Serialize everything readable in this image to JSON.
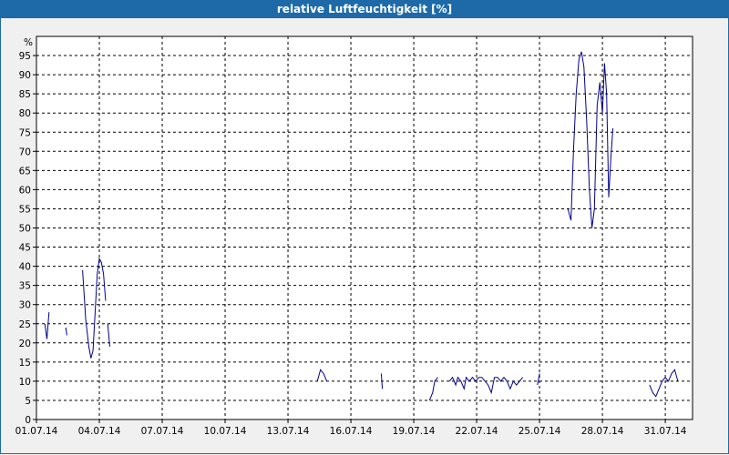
{
  "window": {
    "title": "relative Luftfeuchtigkeit [%]"
  },
  "colors": {
    "titlebar": "#1e6aa8",
    "series": "#00008b",
    "grid": "#000000",
    "background": "#f0f0f0",
    "plot": "#ffffff"
  },
  "chart_data": {
    "type": "line",
    "title": "relative Luftfeuchtigkeit [%]",
    "ylabel": "%",
    "xlabel": "",
    "ylim": [
      0,
      100
    ],
    "xlim": [
      1,
      32.3
    ],
    "yticks": [
      0,
      5,
      10,
      15,
      20,
      25,
      30,
      35,
      40,
      45,
      50,
      55,
      60,
      65,
      70,
      75,
      80,
      85,
      90,
      95
    ],
    "xticks": [
      {
        "x": 1,
        "label": "01.07.14"
      },
      {
        "x": 4,
        "label": "04.07.14"
      },
      {
        "x": 7,
        "label": "07.07.14"
      },
      {
        "x": 10,
        "label": "10.07.14"
      },
      {
        "x": 13,
        "label": "13.07.14"
      },
      {
        "x": 16,
        "label": "16.07.14"
      },
      {
        "x": 19,
        "label": "19.07.14"
      },
      {
        "x": 22,
        "label": "22.07.14"
      },
      {
        "x": 25,
        "label": "25.07.14"
      },
      {
        "x": 28,
        "label": "28.07.14"
      },
      {
        "x": 31,
        "label": "31.07.14"
      }
    ],
    "grid": true,
    "segments": [
      [
        [
          1.4,
          25
        ],
        [
          1.5,
          21
        ],
        [
          1.6,
          28
        ]
      ],
      [
        [
          2.4,
          24
        ],
        [
          2.45,
          22
        ]
      ],
      [
        [
          3.2,
          39
        ],
        [
          3.35,
          26
        ],
        [
          3.5,
          19
        ],
        [
          3.6,
          16
        ],
        [
          3.7,
          18
        ],
        [
          3.8,
          28
        ],
        [
          3.9,
          38
        ],
        [
          4.0,
          42
        ],
        [
          4.1,
          41
        ],
        [
          4.2,
          38
        ],
        [
          4.3,
          31
        ]
      ],
      [
        [
          4.4,
          25
        ],
        [
          4.5,
          19
        ]
      ],
      [
        [
          14.4,
          10
        ],
        [
          14.55,
          13
        ],
        [
          14.7,
          12
        ],
        [
          14.85,
          10
        ]
      ],
      [
        [
          17.45,
          12
        ],
        [
          17.5,
          8
        ]
      ],
      [
        [
          19.75,
          5
        ],
        [
          19.9,
          7
        ],
        [
          20.0,
          10
        ],
        [
          20.15,
          11
        ]
      ],
      [
        [
          20.7,
          10
        ],
        [
          20.85,
          11
        ],
        [
          21.0,
          9
        ],
        [
          21.1,
          11
        ],
        [
          21.25,
          10
        ],
        [
          21.4,
          8
        ],
        [
          21.5,
          11
        ],
        [
          21.65,
          10
        ],
        [
          21.8,
          11
        ],
        [
          21.95,
          10
        ],
        [
          22.1,
          11
        ],
        [
          22.25,
          11
        ],
        [
          22.4,
          10
        ],
        [
          22.55,
          9
        ],
        [
          22.7,
          7
        ],
        [
          22.85,
          11
        ],
        [
          23.0,
          11
        ],
        [
          23.15,
          10
        ],
        [
          23.3,
          11
        ],
        [
          23.45,
          10
        ],
        [
          23.6,
          8
        ],
        [
          23.75,
          10
        ],
        [
          23.9,
          9
        ],
        [
          24.05,
          10
        ],
        [
          24.2,
          11
        ]
      ],
      [
        [
          24.9,
          9
        ],
        [
          25.0,
          12
        ]
      ],
      [
        [
          26.35,
          55
        ],
        [
          26.5,
          52
        ],
        [
          26.62,
          70
        ],
        [
          26.75,
          85
        ],
        [
          26.88,
          94
        ],
        [
          27.0,
          96
        ],
        [
          27.12,
          92
        ],
        [
          27.25,
          78
        ],
        [
          27.38,
          60
        ],
        [
          27.5,
          50
        ],
        [
          27.62,
          55
        ],
        [
          27.75,
          82
        ],
        [
          27.88,
          88
        ],
        [
          28.0,
          80
        ],
        [
          28.1,
          93
        ],
        [
          28.2,
          85
        ],
        [
          28.3,
          58
        ],
        [
          28.4,
          68
        ],
        [
          28.5,
          76
        ]
      ],
      [
        [
          30.25,
          9
        ],
        [
          30.4,
          7
        ],
        [
          30.55,
          6
        ],
        [
          30.7,
          8
        ],
        [
          30.85,
          10
        ],
        [
          31.0,
          11
        ],
        [
          31.15,
          10
        ],
        [
          31.3,
          12
        ],
        [
          31.45,
          13
        ],
        [
          31.6,
          10
        ]
      ]
    ]
  }
}
